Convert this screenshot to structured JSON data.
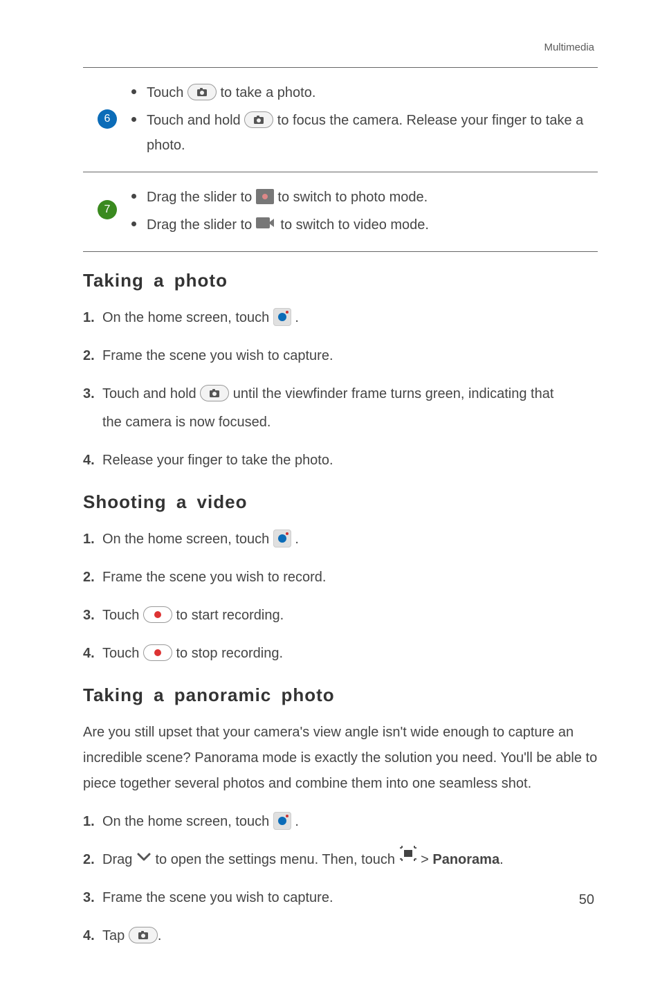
{
  "header": {
    "label": "Multimedia"
  },
  "table": {
    "row6": {
      "num": "6",
      "b1_pre": "Touch ",
      "b1_post": "to take a photo.",
      "b2_pre": "Touch and hold ",
      "b2_mid": "to focus the camera. Release your finger to ",
      "b2_last": "take a photo."
    },
    "row7": {
      "num": "7",
      "b1_pre": "Drag the slider to ",
      "b1_post": " to switch to photo mode.",
      "b2_pre": "Drag the slider to ",
      "b2_post": " to switch to video mode."
    }
  },
  "photo": {
    "heading": "Taking a photo",
    "s1_pre": "On the home screen, touch ",
    "s1_post": " .",
    "s2": "Frame the scene you wish to capture.",
    "s3_pre": "Touch and hold ",
    "s3_mid": "until the viewfinder frame turns green, indicating that ",
    "s3_last": "the camera is now focused.",
    "s4": "Release your finger to take the photo."
  },
  "video": {
    "heading": "Shooting a video",
    "s1_pre": "On the home screen, touch ",
    "s1_post": " .",
    "s2": "Frame the scene you wish to record.",
    "s3_pre": "Touch ",
    "s3_post": "to start recording.",
    "s4_pre": "Touch ",
    "s4_post": "to stop recording."
  },
  "pano": {
    "heading": "Taking a panoramic photo",
    "para": "Are you still upset that your camera's view angle isn't wide enough to capture an incredible scene? Panorama mode is exactly the solution you need. You'll be able to piece together several photos and combine them into one seamless shot.",
    "s1_pre": "On the home screen, touch ",
    "s1_post": " .",
    "s2_pre": "Drag ",
    "s2_mid": " to open the settings menu. Then, touch ",
    "s2_gt": " > ",
    "s2_bold": "Panorama",
    "s2_end": ".",
    "s3": "Frame the scene you wish to capture.",
    "s4_pre": "Tap ",
    "s4_post": "."
  },
  "nums": {
    "n1": "1.",
    "n2": "2.",
    "n3": "3.",
    "n4": "4."
  },
  "page_number": "50"
}
